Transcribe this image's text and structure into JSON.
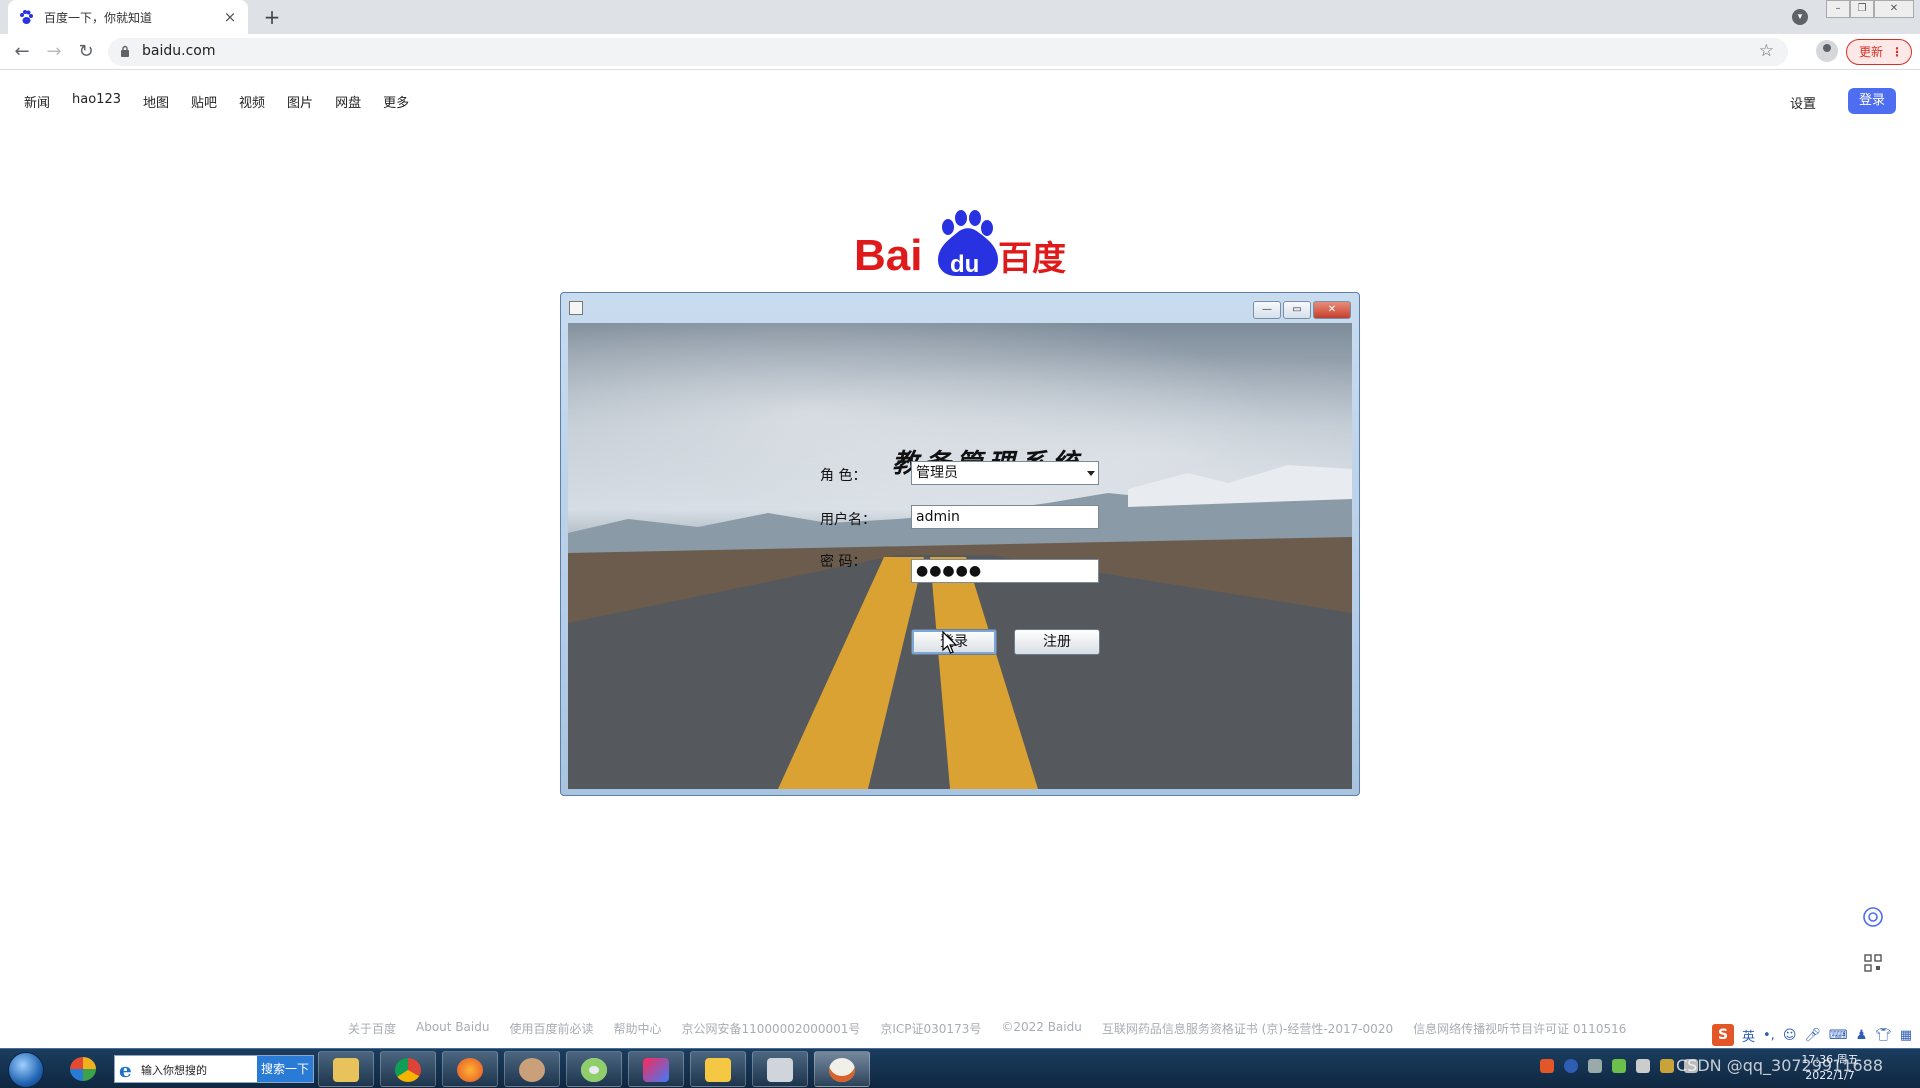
{
  "browser": {
    "tab_title": "百度一下，你就知道",
    "new_tab": "+",
    "url": "baidu.com",
    "update_label": "更新",
    "update_menu": "⋮"
  },
  "baidu": {
    "nav_links": [
      "新闻",
      "hao123",
      "地图",
      "贴吧",
      "视频",
      "图片",
      "网盘",
      "更多"
    ],
    "settings": "设置",
    "login": "登录",
    "logo_text_left": "Bai",
    "logo_text_du": "du",
    "logo_text_right": "百度",
    "footer": [
      "关于百度",
      "About Baidu",
      "使用百度前必读",
      "帮助中心",
      "京公网安备11000002000001号",
      "京ICP证030173号",
      "©2022 Baidu",
      "互联网药品信息服务资格证书 (京)-经营性-2017-0020",
      "信息网络传播视听节目许可证 0110516"
    ]
  },
  "login_window": {
    "title": "教务管理系统",
    "role_label": "角  色：",
    "role_value": "管理员",
    "username_label": "用户名：",
    "username_value": "admin",
    "password_label": "密  码：",
    "password_value": "●●●●●",
    "login_button": "登录",
    "register_button": "注册",
    "min_glyph": "—",
    "max_glyph": "▭",
    "close_glyph": "✕"
  },
  "ime": {
    "logo": "S",
    "mode": "英",
    "punct": "•,"
  },
  "taskbar": {
    "search_placeholder": "输入你想搜的",
    "search_button": "搜索一下",
    "clock_time": "17:36 周五",
    "clock_date": "2022/1/7",
    "watermark": "CSDN @qq_30729911688"
  },
  "colors": {
    "baidu_red": "#de1a1a",
    "baidu_blue": "#2932e1",
    "login_blue": "#4e6ef2"
  }
}
